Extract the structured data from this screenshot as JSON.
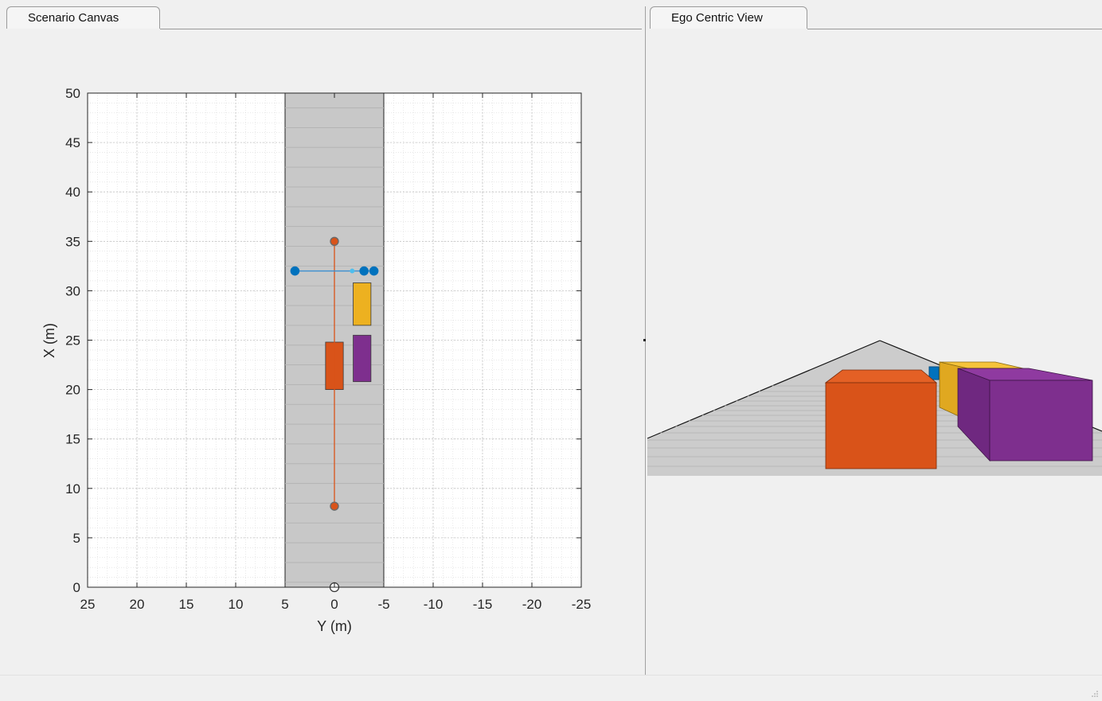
{
  "tabs": {
    "left_label": "Scenario Canvas",
    "right_label": "Ego Centric View"
  },
  "colors": {
    "road": "#c8c8c8",
    "ego": "#d95319",
    "yellow_car": "#edb120",
    "purple_car": "#7e2f8e",
    "blue_waypoint": "#0072bd",
    "cyan_waypoint": "#4dbeee"
  },
  "chart_data": {
    "type": "scatter",
    "title": "",
    "xlabel": "Y (m)",
    "ylabel": "X (m)",
    "xlim": [
      25,
      -25
    ],
    "ylim": [
      0,
      50
    ],
    "xticks": [
      25,
      20,
      15,
      10,
      5,
      0,
      -5,
      -10,
      -15,
      -20,
      -25
    ],
    "yticks": [
      0,
      5,
      10,
      15,
      20,
      25,
      30,
      35,
      40,
      45,
      50
    ],
    "grid": true,
    "road": {
      "y_min": -5,
      "y_max": 5,
      "x_min": 0,
      "x_max": 50
    },
    "vehicles": [
      {
        "name": "ego",
        "y_center": 0,
        "x_min": 20,
        "x_max": 24.8,
        "width": 1.8,
        "color": "#d95319"
      },
      {
        "name": "car-yellow",
        "y_center": -2.8,
        "x_min": 26.5,
        "x_max": 30.8,
        "width": 1.8,
        "color": "#edb120"
      },
      {
        "name": "car-purple",
        "y_center": -2.8,
        "x_min": 20.8,
        "x_max": 25.5,
        "width": 1.8,
        "color": "#7e2f8e"
      }
    ],
    "ego_path": {
      "points": [
        [
          0,
          8.2
        ],
        [
          0,
          35
        ]
      ],
      "color": "#d95319"
    },
    "pedestrian_path": {
      "points": [
        [
          4,
          32
        ],
        [
          -3,
          32
        ],
        [
          -4,
          32
        ]
      ],
      "color": "#0072bd",
      "current": [
        -1.8,
        32
      ]
    },
    "origin_marker": [
      0,
      0
    ]
  }
}
